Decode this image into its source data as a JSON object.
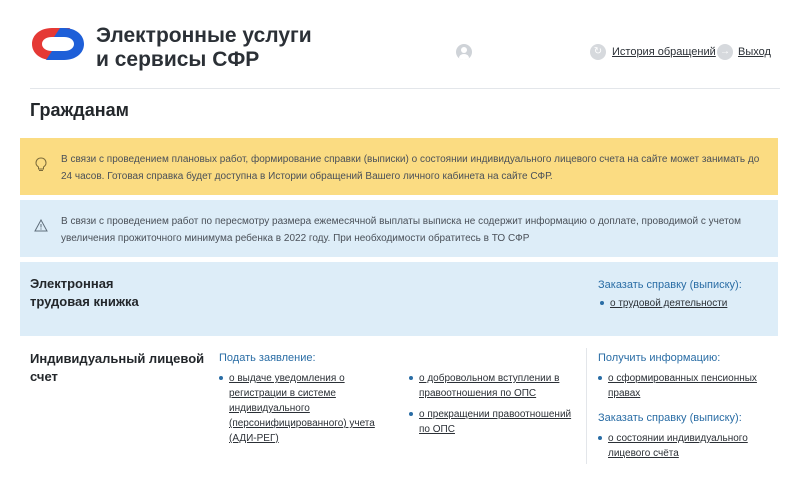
{
  "header": {
    "brand_line1": "Электронные услуги",
    "brand_line2": "и сервисы СФР",
    "history_link": "История обращений",
    "exit_link": "Выход",
    "logo_colors": {
      "red": "#e53935",
      "blue": "#1e5fd8"
    }
  },
  "page": {
    "title": "Гражданам"
  },
  "alerts": [
    {
      "icon": "lightbulb-icon",
      "text": "В связи с проведением плановых работ, формирование справки (выписки) о состоянии индивидуального лицевого счета на сайте может занимать до 24 часов. Готовая справка будет доступна в Истории обращений Вашего личного кабинета на сайте СФР.",
      "color": "#fbdc82"
    },
    {
      "icon": "warning-icon",
      "text": "В связи с проведением работ по пересмотру размера ежемесячной выплаты выписка не содержит информацию о доплате, проводимой с учетом увеличения прожиточного минимума ребенка в 2022 году. При необходимости обратитесь в ТО СФР",
      "color": "#ddedf8"
    }
  ],
  "cards": {
    "labor_book": {
      "title_line1": "Электронная",
      "title_line2": "трудовая книжка",
      "order_head": "Заказать справку (выписку):",
      "order_items": [
        "о трудовой деятельности"
      ]
    },
    "personal_account": {
      "title_line1": "Индивидуальный лицевой",
      "title_line2": "счет",
      "apply_head": "Подать заявление:",
      "apply_col1": [
        "о выдаче уведомления о регистрации в системе индивидуального (персонифицированного) учета (АДИ-РЕГ)"
      ],
      "apply_col2": [
        "о добровольном вступлении в правоотношения по ОПС",
        "о прекращении правоотношений по ОПС"
      ],
      "info_head": "Получить информацию:",
      "info_items": [
        "о сформированных пенсионных правах"
      ],
      "order_head": "Заказать справку (выписку):",
      "order_items": [
        "о состоянии индивидуального лицевого счёта"
      ]
    }
  }
}
